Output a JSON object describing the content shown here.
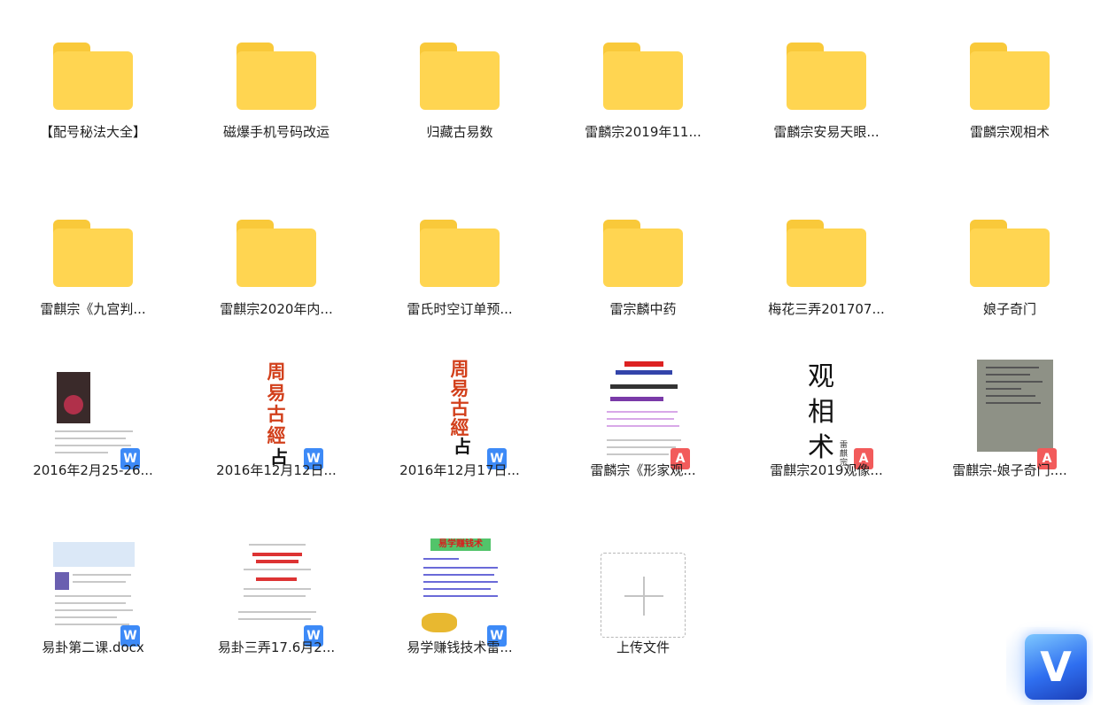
{
  "folders": [
    {
      "label": "【配号秘法大全】"
    },
    {
      "label": "磁爆手机号码改运"
    },
    {
      "label": "归藏古易数"
    },
    {
      "label": "雷麟宗2019年11..."
    },
    {
      "label": "雷麟宗安易天眼..."
    },
    {
      "label": "雷麟宗观相术"
    },
    {
      "label": "雷麒宗《九宫判..."
    },
    {
      "label": "雷麒宗2020年内..."
    },
    {
      "label": "雷氏时空订单预..."
    },
    {
      "label": "雷宗麟中药"
    },
    {
      "label": "梅花三弄201707..."
    },
    {
      "label": "娘子奇门"
    }
  ],
  "files": [
    {
      "label": "2016年2月25-26...",
      "type": "W"
    },
    {
      "label": "2016年12月12日...",
      "type": "W",
      "thumb_text": "周易古經",
      "thumb_text2": "占"
    },
    {
      "label": "2016年12月17日...",
      "type": "W",
      "thumb_text": "周易古經",
      "thumb_text2": "占"
    },
    {
      "label": "雷麟宗《形家观...",
      "type": "PDF"
    },
    {
      "label": "雷麒宗2019观像...",
      "type": "PDF",
      "thumb_text": "观相术",
      "thumb_text2": "雷麒宗"
    },
    {
      "label": "雷麒宗-娘子奇门....",
      "type": "PDF"
    },
    {
      "label": "易卦第二课.docx",
      "type": "W"
    },
    {
      "label": "易卦三弄17.6月2...",
      "type": "W"
    },
    {
      "label": "易学赚钱技术雷...",
      "type": "W",
      "thumb_text": "易学赚钱术"
    }
  ],
  "upload": {
    "label": "上传文件"
  },
  "badges": {
    "word": "W",
    "pdf": "A"
  },
  "colors": {
    "folder": "#ffd551",
    "folder_tab": "#f9c93a",
    "word": "#3d8af7",
    "pdf": "#f25b5b"
  },
  "logo": {
    "letter": "V"
  }
}
